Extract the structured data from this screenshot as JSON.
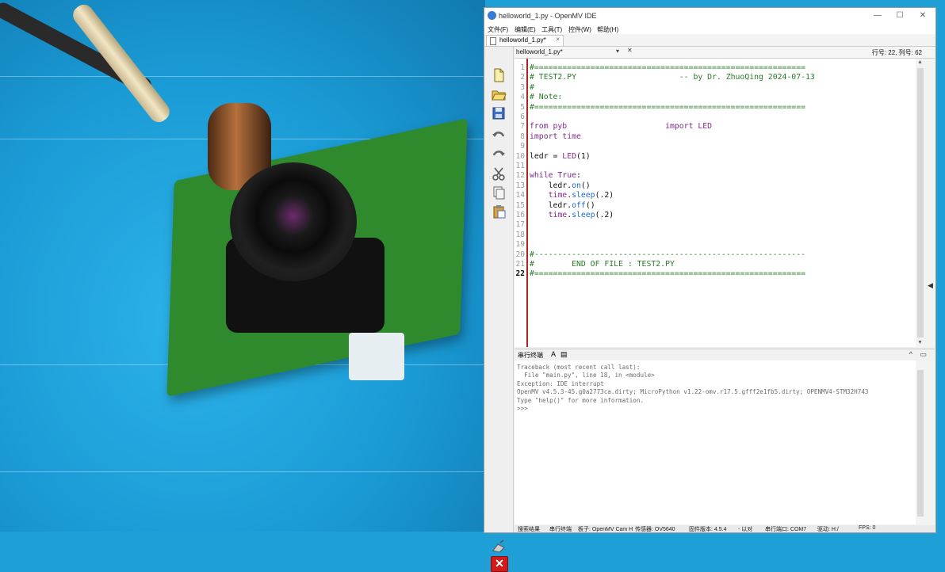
{
  "window": {
    "title": "helloworld_1.py - OpenMV IDE",
    "controls": [
      "—",
      "☐",
      "✕"
    ]
  },
  "menu": [
    "文件(F)",
    "编辑(E)",
    "工具(T)",
    "控件(W)",
    "帮助(H)"
  ],
  "tab": {
    "label": "helloworld_1.py*",
    "close": "×"
  },
  "editor": {
    "filename": "helloworld_1.py*",
    "dropdown": "▾",
    "close": "✕",
    "position": "行号: 22, 列号: 62",
    "line_numbers": [
      "1",
      "2",
      "3",
      "4",
      "5",
      "6",
      "7",
      "8",
      "9",
      "10",
      "11",
      "12",
      "13",
      "14",
      "15",
      "16",
      "17",
      "18",
      "19",
      "20",
      "21",
      "22"
    ],
    "lines": [
      "#==========================================================",
      "# TEST2.PY                      -- by Dr. ZhuoQing 2024-07-13",
      "#",
      "# Note:",
      "#==========================================================",
      "",
      "from pyb                     import LED",
      "import time",
      "",
      "ledr = LED(1)",
      "",
      "while True:",
      "    ledr.on()",
      "    time.sleep(.2)",
      "    ledr.off()",
      "    time.sleep(.2)",
      "",
      "",
      "",
      "#----------------------------------------------------------",
      "#        END OF FILE : TEST2.PY",
      "#=========================================================="
    ]
  },
  "terminal": {
    "title": "串行终端",
    "lines": [
      "Traceback (most recent call last):",
      "  File \"main.py\", line 18, in <module>",
      "Exception: IDE interrupt",
      "OpenMV v4.5.3-45.g0a2773ca.dirty; MicroPython v1.22-omv.r17.5.gfff2e1fb5.dirty; OPENMV4-STM32H743",
      "Type \"help()\" for more information.",
      ">>>"
    ]
  },
  "statusbar": [
    "搜索结果",
    "串行终端",
    "板子: OpenMV Cam H",
    "传感器: OV5640",
    "固件版本: 4.5.4",
    "- 以对",
    "串行端口: COM7",
    "驱动: H:/",
    "FPS: 0"
  ],
  "colors": {
    "keyword": "#7a2a8a",
    "comment": "#2a7a2a",
    "function": "#1c6ad0",
    "gutter_border": "#b22222",
    "stop": "#d21a1a"
  },
  "toolbar_icons": [
    "new-file-icon",
    "open-folder-icon",
    "save-icon",
    "undo-icon",
    "redo-icon",
    "cut-icon",
    "copy-icon",
    "paste-icon",
    "connect-icon",
    "stop-icon"
  ]
}
